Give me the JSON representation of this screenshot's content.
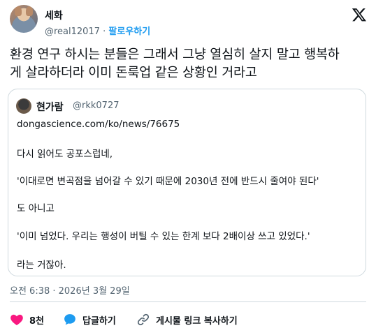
{
  "author": {
    "name": "세화",
    "handle": "@real12017",
    "separator": "·",
    "follow_label": "팔로우하기"
  },
  "tweet": {
    "text_line1": "환경 연구 하시는 분들은 그래서 그냥 열심히 살지 말고 행복하",
    "text_line2": "게 살라하더라 이미 돈룩업 같은 상황인 거라고"
  },
  "quote": {
    "name": "현가람",
    "handle": "@rkk0727",
    "lines": [
      "dongascience.com/ko/news/76675",
      "다시 읽어도 공포스럽네,",
      "'이대로면 변곡점을 넘어갈 수 있기 때문에 2030년 전에 반드시 줄여야 된다'",
      "도 아니고",
      "'이미 넘었다. 우리는 행성이 버틸 수 있는 한계 보다 2배이상 쓰고 있었다.'",
      "라는 거잖아."
    ]
  },
  "timestamp": "오전 6:38 · 2026년 3월 29일",
  "actions": {
    "like_count": "8천",
    "reply_label": "답글하기",
    "copy_link_label": "게시물 링크 복사하기"
  },
  "colors": {
    "accent": "#1d9bf0",
    "like": "#f91880",
    "muted": "#536471",
    "border": "#cfd9de"
  },
  "icons": [
    "x-logo-icon",
    "heart-icon",
    "speech-bubble-icon",
    "link-icon"
  ]
}
